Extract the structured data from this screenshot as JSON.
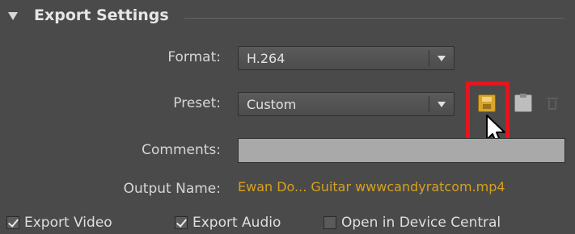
{
  "section": {
    "title": "Export Settings"
  },
  "format": {
    "label": "Format:",
    "value": "H.264"
  },
  "preset": {
    "label": "Preset:",
    "value": "Custom",
    "icons": [
      "save-preset-icon",
      "import-preset-icon",
      "delete-preset-icon"
    ]
  },
  "comments": {
    "label": "Comments:",
    "value": ""
  },
  "output": {
    "label": "Output Name:",
    "value": "Ewan Do...  Guitar  wwwcandyratcom.mp4"
  },
  "checkboxes": [
    {
      "label": "Export Video",
      "checked": true
    },
    {
      "label": "Export Audio",
      "checked": true
    },
    {
      "label": "Open in Device Central",
      "checked": false
    }
  ],
  "colors": {
    "panel_bg": "#4a4a4a",
    "output_link": "#d6a11e",
    "highlight": "#e8141c",
    "save_icon": "#d8a52a"
  }
}
